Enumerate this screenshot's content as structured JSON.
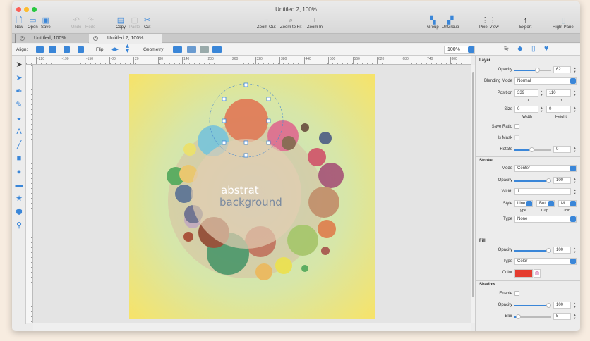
{
  "window": {
    "title": "Untitled 2, 100%"
  },
  "toolbar": {
    "new": "New",
    "open": "Open",
    "save": "Save",
    "undo": "Undo",
    "redo": "Redo",
    "copy": "Copy",
    "paste": "Paste",
    "cut": "Cut",
    "zoom_out": "Zoom Out",
    "zoom_fit": "Zoom to Fit",
    "zoom_in": "Zoom In",
    "group": "Group",
    "ungroup": "UnGroup",
    "pixel_view": "Pixel View",
    "export": "Export",
    "right_panel": "Right Panel"
  },
  "tabs": [
    {
      "label": "Untitled, 100%"
    },
    {
      "label": "Untitled 2, 100%"
    }
  ],
  "alignbar": {
    "align": "Align:",
    "flip": "Flip:",
    "geometry": "Geometry:",
    "zoom": "100%"
  },
  "ruler": [
    "-220",
    "-190",
    "-150",
    "-80",
    "20",
    "80",
    "140",
    "200",
    "260",
    "320",
    "380",
    "440",
    "500",
    "560",
    "620",
    "680",
    "740",
    "800"
  ],
  "canvas": {
    "text_line1": "abstrat",
    "text_line2": "background"
  },
  "panel": {
    "layer": {
      "title": "Layer",
      "opacity_label": "Opacity",
      "opacity": "62",
      "opacity_fraction": 0.62,
      "blend_label": "Blending Mode",
      "blend": "Normal",
      "position_label": "Position",
      "x": "339",
      "y": "110",
      "x_label": "X",
      "y_label": "Y",
      "size_label": "Size",
      "width": "0",
      "height": "0",
      "width_label": "Width",
      "height_label": "Height",
      "save_ratio": "Save Ratio",
      "is_mask": "Is Mask",
      "rotate_label": "Rotate",
      "rotate": "0"
    },
    "stroke": {
      "title": "Stroke",
      "mode_label": "Mode",
      "mode": "Center",
      "opacity_label": "Opacity",
      "opacity": "100",
      "width_label": "Width",
      "width": "1",
      "style_label": "Style",
      "type_val": "Line",
      "cap_val": "Butt",
      "join_val": "M...",
      "type_label": "Type",
      "cap_label": "Cap",
      "join_label": "Join",
      "type2_label": "Type",
      "type2": "None"
    },
    "fill": {
      "title": "Fill",
      "opacity_label": "Opacity",
      "opacity": "100",
      "type_label": "Type",
      "type": "Color",
      "color_label": "Color",
      "color": "#e53c2f"
    },
    "shadow": {
      "title": "Shadow",
      "enable_label": "Enable",
      "opacity_label": "Opacity",
      "opacity": "100",
      "blur_label": "Blur",
      "blur": "5"
    }
  }
}
